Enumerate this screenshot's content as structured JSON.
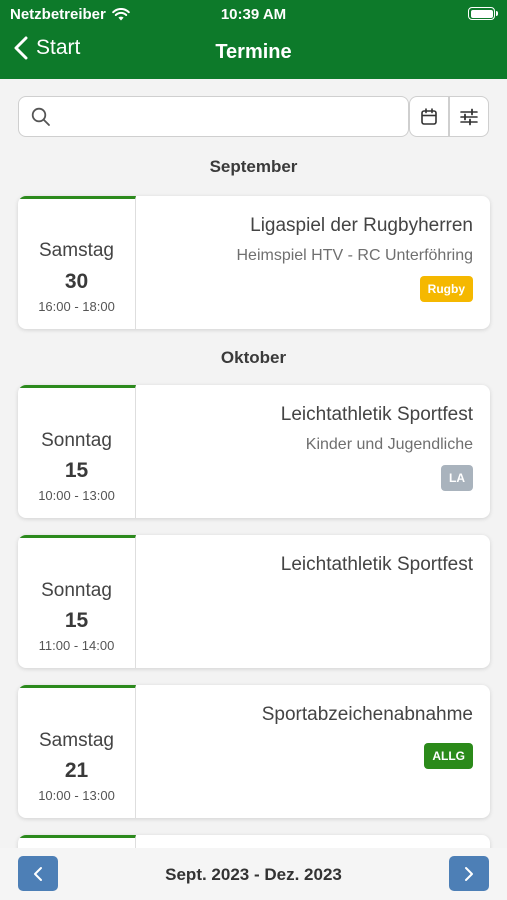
{
  "status": {
    "carrier": "Netzbetreiber",
    "time": "10:39 AM"
  },
  "nav": {
    "back_label": "Start",
    "title": "Termine"
  },
  "search": {
    "placeholder": "",
    "value": ""
  },
  "colors": {
    "header": "#0d7a2a",
    "accent_line": "#2c8a1d",
    "rugby": "#f5b800",
    "la": "#a9b3bd",
    "allg": "#2b8a1a",
    "pager": "#4d7fb6"
  },
  "sections": [
    {
      "month": "September"
    },
    {
      "month": "Oktober"
    }
  ],
  "events": [
    {
      "weekday": "Samstag",
      "day": "30",
      "time": "16:00 - 18:00",
      "title": "Ligaspiel der Rugbyherren",
      "subtitle": "Heimspiel HTV - RC Unterföhring",
      "tag": "Rugby"
    },
    {
      "weekday": "Sonntag",
      "day": "15",
      "time": "10:00 - 13:00",
      "title": "Leichtathletik Sportfest",
      "subtitle": "Kinder und Jugendliche",
      "tag": "LA"
    },
    {
      "weekday": "Sonntag",
      "day": "15",
      "time": "11:00 - 14:00",
      "title": "Leichtathletik Sportfest",
      "subtitle": "",
      "tag": ""
    },
    {
      "weekday": "Samstag",
      "day": "21",
      "time": "10:00 - 13:00",
      "title": "Sportabzeichenabnahme",
      "subtitle": "",
      "tag": "ALLG"
    }
  ],
  "footer": {
    "range": "Sept. 2023 - Dez. 2023"
  }
}
